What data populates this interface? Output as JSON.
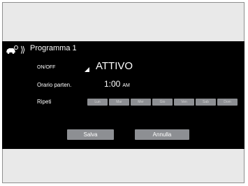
{
  "header": {
    "title": "Programma 1",
    "icon": "car-timer-icon"
  },
  "rows": {
    "onoff": {
      "label": "ON/OFF",
      "value": "ATTIVO"
    },
    "time": {
      "label": "Orario parten.",
      "value": "1:00",
      "period": "AM"
    },
    "repeat": {
      "label": "Ripeti",
      "days": [
        "Lun",
        "Mar",
        "Mer",
        "Gio",
        "Ven",
        "Sab",
        "Dom"
      ]
    }
  },
  "buttons": {
    "save": "Salva",
    "cancel": "Annulla"
  },
  "colors": {
    "screen": "#000000",
    "button": "#8d8f93",
    "frame": "#e9e9e9"
  }
}
